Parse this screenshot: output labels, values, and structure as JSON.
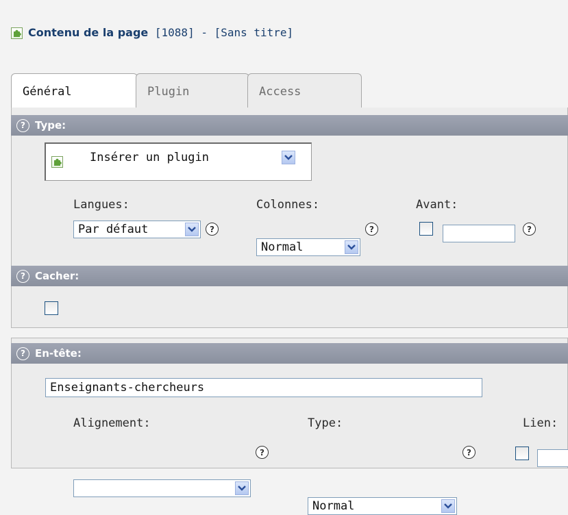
{
  "header": {
    "title_strong": "Contenu de la page",
    "title_rest": " [1088] - [Sans titre]",
    "icon": "plugin-puzzle-icon"
  },
  "tabs": [
    {
      "label": "Général",
      "active": true
    },
    {
      "label": "Plugin",
      "active": false
    },
    {
      "label": "Access",
      "active": false
    }
  ],
  "type_section": {
    "header": "Type:",
    "select_value": "Insérer un plugin",
    "select_icon": "plugin-puzzle-icon"
  },
  "fields_row1": {
    "langues_label": "Langues:",
    "langues_value": "Par défaut",
    "colonnes_label": "Colonnes:",
    "colonnes_value": "Normal",
    "avant_label": "Avant:",
    "avant_value": ""
  },
  "cacher_section": {
    "header": "Cacher:"
  },
  "entete_section": {
    "header": "En-tête:",
    "value": "Enseignants-chercheurs",
    "alignement_label": "Alignement:",
    "alignement_value": "",
    "type_label": "Type:",
    "type_value": "Normal",
    "lien_label": "Lien:",
    "lien_value": ""
  },
  "help_glyph": "?",
  "colors": {
    "section_header_bg": "#949aa8",
    "title_blue": "#1a3f6e",
    "dropdown_blue": "#b4c8f0"
  }
}
